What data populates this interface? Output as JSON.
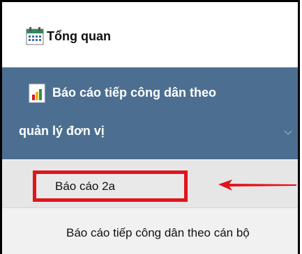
{
  "menu": {
    "overview_label": "Tổng quan",
    "report_group": {
      "line1": "Báo cáo tiếp công dân theo",
      "line2": "quản lý đơn vị"
    },
    "sub_items": [
      {
        "label": "Báo cáo 2a"
      },
      {
        "label": "Báo cáo tiếp công dân theo cán bộ"
      }
    ]
  },
  "colors": {
    "active_bg": "#4c6f91",
    "highlight_border": "#e0141c"
  },
  "icons": {
    "overview": "calendar-icon",
    "report": "report-icon",
    "expand": "chevron-down-icon",
    "annotation": "red-arrow"
  }
}
